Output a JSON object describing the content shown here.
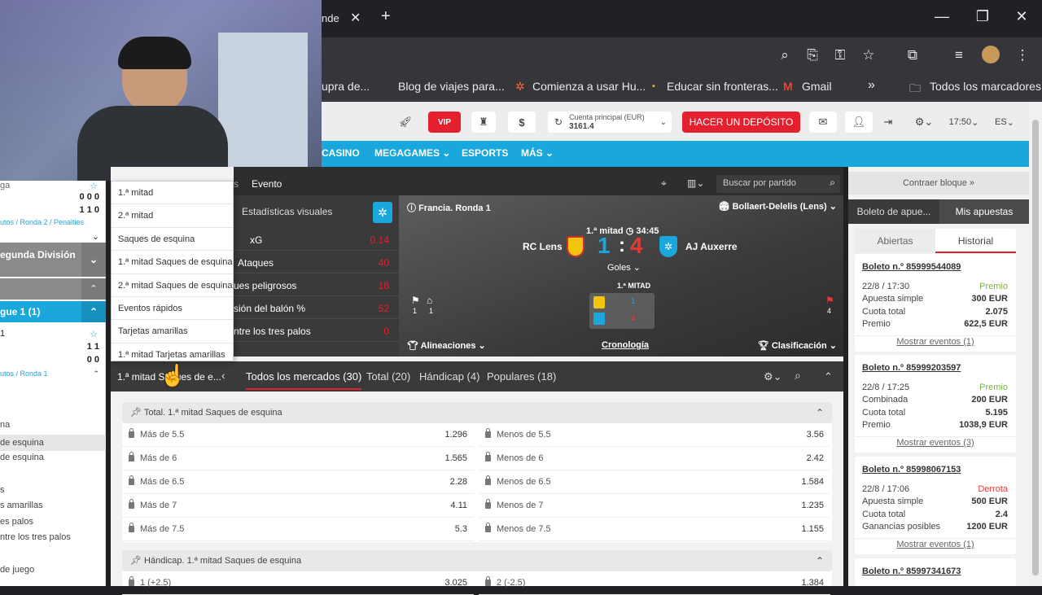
{
  "browser": {
    "tab_partial": "nde",
    "bookmarks": [
      "upra de...",
      "Blog de viajes para...",
      "Comienza a usar Hu...",
      "Educar sin fronteras...",
      "Gmail",
      "Todos los marcadores"
    ],
    "more": "»"
  },
  "header": {
    "vip": "VIP",
    "account_label": "Cuenta principal (EUR)",
    "account_value": "3161.4",
    "deposit": "HACER UN DEPÓSITO",
    "time": "17:50",
    "lang": "ES"
  },
  "nav": {
    "items": [
      "CASINO",
      "MEGAGAMES",
      "ESPORTS",
      "MÁS"
    ]
  },
  "left": {
    "rows": [
      "ga",
      "0 0 0",
      "1 1 0",
      "utos / Ronda 2 / Penalties",
      "egunda División",
      "gue 1 (1)",
      "1",
      "1 1",
      "0 0",
      "utos / Ronda 1",
      "na",
      "de esquina",
      "de esquina",
      "s",
      "s amarillas",
      "es palos",
      "ntre los tres palos",
      "de juego"
    ]
  },
  "dropdown": {
    "items": [
      "1.ª mitad",
      "2.ª mitad",
      "Saques de esquina",
      "1.ª mitad Saques de esquina",
      "2.ª mitad Saques de esquina",
      "Eventos rápidos",
      "Tarjetas amarillas",
      "1.ª mitad Tarjetas amarillas"
    ]
  },
  "topbar": {
    "tab_partial": "s",
    "tab_event": "Evento",
    "search_placeholder": "Buscar por partido",
    "collapse": "Contraer bloque »"
  },
  "stats": {
    "title": "Estadísticas visuales",
    "rows": [
      {
        "label": "xG",
        "value": "0.14"
      },
      {
        "label": "Ataques",
        "value": "40"
      },
      {
        "label": "ues peligrosos",
        "value": "18"
      },
      {
        "label": "sión del balón %",
        "value": "52"
      },
      {
        "label": "ntre los tres palos",
        "value": "0"
      }
    ]
  },
  "match": {
    "league": "Francia. Ronda 1",
    "stadium": "Bollaert-Delelis (Lens)",
    "period": "1.ª mitad",
    "clock": "34:45",
    "home": "RC Lens",
    "away": "AJ Auxerre",
    "score_home": "1",
    "score_sep": ":",
    "score_away": "4",
    "goals_label": "Goles",
    "half_label": "1.ª MITAD",
    "home_half": "1",
    "away_half": "4",
    "flag_left_1": "1",
    "flag_left_2": "1",
    "flag_right": "4",
    "lineups": "Alineaciones",
    "chronology": "Cronología",
    "standings": "Clasificación"
  },
  "markets": {
    "selected": "1.ª mitad Saques de e...",
    "tabs": [
      "Todos los mercados (30)",
      "Total (20)",
      "Hándicap (4)",
      "Populares (18)"
    ]
  },
  "panel_total": {
    "title": "Total. 1.ª mitad Saques de esquina",
    "rows": [
      {
        "l": "Más de 5.5",
        "lv": "1.296",
        "r": "Menos de 5.5",
        "rv": "3.56"
      },
      {
        "l": "Más de 6",
        "lv": "1.565",
        "r": "Menos de 6",
        "rv": "2.42"
      },
      {
        "l": "Más de 6.5",
        "lv": "2.28",
        "r": "Menos de 6.5",
        "rv": "1.584"
      },
      {
        "l": "Más de 7",
        "lv": "4.11",
        "r": "Menos de 7",
        "rv": "1.235"
      },
      {
        "l": "Más de 7.5",
        "lv": "5.3",
        "r": "Menos de 7.5",
        "rv": "1.155"
      }
    ]
  },
  "panel_handicap": {
    "title": "Hándicap. 1.ª mitad Saques de esquina",
    "rows": [
      {
        "l": "1 (+2.5)",
        "lv": "3.025",
        "r": "2 (-2.5)",
        "rv": "1.384"
      }
    ]
  },
  "right": {
    "tab_slip": "Boleto de apue...",
    "tab_mybets": "Mis apuestas",
    "sub_open": "Abiertas",
    "sub_history": "Historial",
    "bets": [
      {
        "id": "Boleto n.º 85999544089",
        "date": "22/8 / 17:30",
        "status": "Premio",
        "type": "Apuesta simple",
        "amount": "300 EUR",
        "odds_label": "Cuota total",
        "odds": "2.075",
        "prize_label": "Premio",
        "prize": "622,5 EUR",
        "show": "Mostrar eventos (1)"
      },
      {
        "id": "Boleto n.º 85999203597",
        "date": "22/8 / 17:25",
        "status": "Premio",
        "type": "Combinada",
        "amount": "200 EUR",
        "odds_label": "Cuota total",
        "odds": "5.195",
        "prize_label": "Premio",
        "prize": "1038,9 EUR",
        "show": "Mostrar eventos (3)"
      },
      {
        "id": "Boleto n.º 85998067153",
        "date": "22/8 / 17:06",
        "status": "Derrota",
        "type": "Apuesta simple",
        "amount": "500 EUR",
        "odds_label": "Cuota total",
        "odds": "2.4",
        "prize_label": "Ganancias posibles",
        "prize": "1200 EUR",
        "show": "Mostrar eventos (1)"
      },
      {
        "id": "Boleto n.º 85997341673"
      }
    ]
  },
  "colors": {
    "accent_red": "#e5202e",
    "nav_blue": "#1aa7dc",
    "win_green": "#7cb342",
    "loss_red": "#e53935"
  }
}
